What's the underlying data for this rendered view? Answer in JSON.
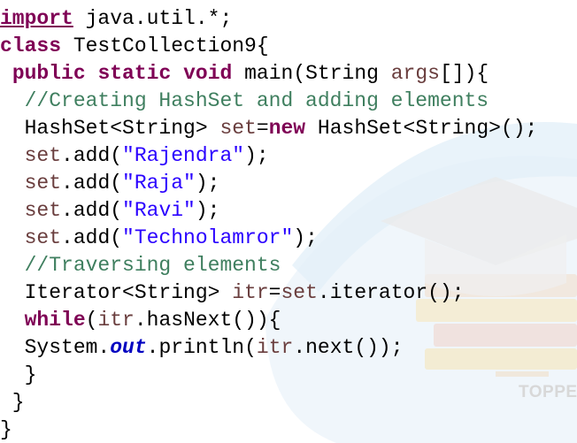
{
  "watermark": {
    "brand_text": "TOPPERV"
  },
  "code": {
    "l1": {
      "kw": "import",
      "rest": " java.util.*;"
    },
    "l2": {
      "kw": "class",
      "rest": " TestCollection9{"
    },
    "l3": {
      "indent": " ",
      "kw1": "public",
      "kw2": "static",
      "kw3": "void",
      "mid": " main(String ",
      "var": "args",
      "end": "[]){"
    },
    "l4": {
      "indent": "  ",
      "comment": "//Creating HashSet and adding elements"
    },
    "l5": {
      "indent": "  ",
      "a": "HashSet<String> ",
      "var": "set",
      "b": "=",
      "kw": "new",
      "c": " HashSet<String>();"
    },
    "l6": {
      "indent": "  ",
      "var": "set",
      "a": ".add(",
      "str": "\"Rajendra\"",
      "b": ");"
    },
    "l7": {
      "indent": "  ",
      "var": "set",
      "a": ".add(",
      "str": "\"Raja\"",
      "b": ");"
    },
    "l8": {
      "indent": "  ",
      "var": "set",
      "a": ".add(",
      "str": "\"Ravi\"",
      "b": ");"
    },
    "l9": {
      "indent": "  ",
      "var": "set",
      "a": ".add(",
      "str": "\"Technolamror\"",
      "b": ");"
    },
    "l10": {
      "indent": "  ",
      "comment": "//Traversing elements"
    },
    "l11": {
      "indent": "  ",
      "a": "Iterator<String> ",
      "var1": "itr",
      "b": "=",
      "var2": "set",
      "c": ".iterator();"
    },
    "l12": {
      "indent": "  ",
      "kw": "while",
      "a": "(",
      "var": "itr",
      "b": ".hasNext()){"
    },
    "l13": {
      "indent": "  ",
      "a": "System.",
      "fld": "out",
      "b": ".println(",
      "var": "itr",
      "c": ".next());"
    },
    "l14": {
      "text": "  }"
    },
    "l15": {
      "text": " }"
    },
    "l16": {
      "text": "}"
    }
  }
}
